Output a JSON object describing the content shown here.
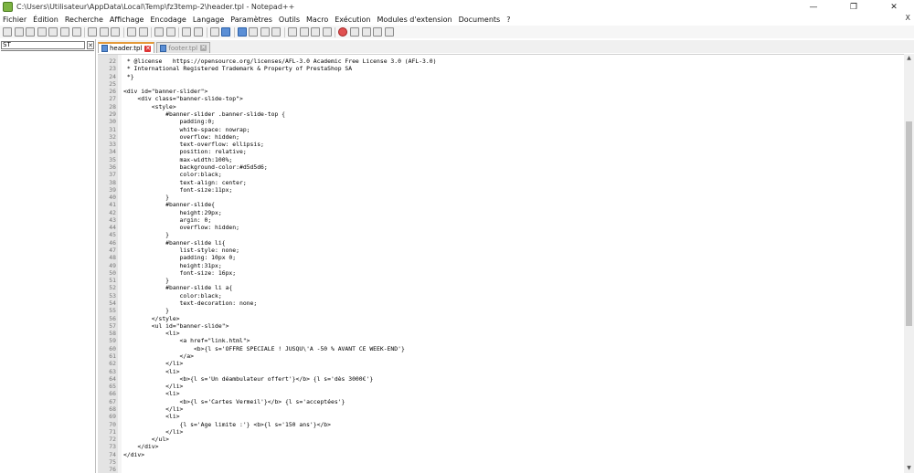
{
  "window": {
    "title": "C:\\Users\\Utilisateur\\AppData\\Local\\Temp\\fz3temp-2\\header.tpl - Notepad++",
    "minimize": "—",
    "maximize": "❐",
    "close": "✕"
  },
  "menu": {
    "items": [
      "Fichier",
      "Édition",
      "Recherche",
      "Affichage",
      "Encodage",
      "Langage",
      "Paramètres",
      "Outils",
      "Macro",
      "Exécution",
      "Modules d'extension",
      "Documents",
      "?"
    ],
    "close": "X"
  },
  "toolbar": {
    "buttons": [
      "new-file",
      "open-file",
      "save",
      "save-all",
      "close",
      "close-all",
      "print",
      "cut",
      "copy",
      "paste",
      "undo",
      "redo",
      "find",
      "replace",
      "zoom-in",
      "zoom-out",
      "sync-vertical",
      "sync-horizontal",
      "word-wrap",
      "show-all-chars",
      "indent-guide",
      "user-defined-language",
      "document-map",
      "function-list",
      "folder-as-workspace",
      "monitoring",
      "record-macro",
      "stop-recording",
      "play-macro",
      "run-macro-multiple",
      "save-macro"
    ]
  },
  "left_panel": {
    "search_value": "ST",
    "close": "✕"
  },
  "tabs": [
    {
      "label": "header.tpl",
      "active": true
    },
    {
      "label": "footer.tpl",
      "active": false
    }
  ],
  "editor": {
    "lines": [
      {
        "n": "22",
        "code": " * @license   https://opensource.org/licenses/AFL-3.0 Academic Free License 3.0 (AFL-3.0)"
      },
      {
        "n": "23",
        "code": " * International Registered Trademark & Property of PrestaShop SA"
      },
      {
        "n": "24",
        "code": " *}"
      },
      {
        "n": "25",
        "code": ""
      },
      {
        "n": "26",
        "code": "<div id=\"banner-slider\">"
      },
      {
        "n": "27",
        "code": "    <div class=\"banner-slide-top\">"
      },
      {
        "n": "28",
        "code": "        <style>"
      },
      {
        "n": "29",
        "code": "            #banner-slider .banner-slide-top {"
      },
      {
        "n": "30",
        "code": "                padding:0;"
      },
      {
        "n": "31",
        "code": "                white-space: nowrap;"
      },
      {
        "n": "32",
        "code": "                overflow: hidden;"
      },
      {
        "n": "33",
        "code": "                text-overflow: ellipsis;"
      },
      {
        "n": "34",
        "code": "                position: relative;"
      },
      {
        "n": "35",
        "code": "                max-width:100%;"
      },
      {
        "n": "36",
        "code": "                background-color:#d5d5d6;"
      },
      {
        "n": "37",
        "code": "                color:black;"
      },
      {
        "n": "38",
        "code": "                text-align: center;"
      },
      {
        "n": "39",
        "code": "                font-size:11px;"
      },
      {
        "n": "40",
        "code": "            }"
      },
      {
        "n": "41",
        "code": "            #banner-slide{"
      },
      {
        "n": "42",
        "code": "                height:29px;"
      },
      {
        "n": "43",
        "code": "                argin: 0;"
      },
      {
        "n": "44",
        "code": "                overflow: hidden;"
      },
      {
        "n": "45",
        "code": "            }"
      },
      {
        "n": "46",
        "code": "            #banner-slide li{"
      },
      {
        "n": "47",
        "code": "                list-style: none;"
      },
      {
        "n": "48",
        "code": "                padding: 10px 0;"
      },
      {
        "n": "49",
        "code": "                height:31px;"
      },
      {
        "n": "50",
        "code": "                font-size: 16px;"
      },
      {
        "n": "51",
        "code": "            }"
      },
      {
        "n": "52",
        "code": "            #banner-slide li a{"
      },
      {
        "n": "53",
        "code": "                color:black;"
      },
      {
        "n": "54",
        "code": "                text-decoration: none;"
      },
      {
        "n": "55",
        "code": "            }"
      },
      {
        "n": "56",
        "code": "        </style>"
      },
      {
        "n": "57",
        "code": "        <ul id=\"banner-slide\">"
      },
      {
        "n": "58",
        "code": "            <li>"
      },
      {
        "n": "59",
        "code": "                <a href=\"link.html\">"
      },
      {
        "n": "60",
        "code": "                    <b>{l s='OFFRE SPECIALE ! JUSQU\\'A -50 % AVANT CE WEEK-END'}"
      },
      {
        "n": "61",
        "code": "                </a>"
      },
      {
        "n": "62",
        "code": "            </li>"
      },
      {
        "n": "63",
        "code": "            <li>"
      },
      {
        "n": "64",
        "code": "                <b>{l s='Un déambulateur offert'}</b> {l s='dès 3000€'}"
      },
      {
        "n": "65",
        "code": "            </li>"
      },
      {
        "n": "66",
        "code": "            <li>"
      },
      {
        "n": "67",
        "code": "                <b>{l s='Cartes Vermeil'}</b> {l s='acceptées'}"
      },
      {
        "n": "68",
        "code": "            </li>"
      },
      {
        "n": "69",
        "code": "            <li>"
      },
      {
        "n": "70",
        "code": "                {l s='Age limite :'} <b>{l s='150 ans'}</b>"
      },
      {
        "n": "71",
        "code": "            </li>"
      },
      {
        "n": "72",
        "code": "        </ul>"
      },
      {
        "n": "73",
        "code": "    </div>"
      },
      {
        "n": "74",
        "code": "</div>"
      },
      {
        "n": "75",
        "code": ""
      },
      {
        "n": "76",
        "code": ""
      }
    ]
  },
  "scrollbar": {
    "up": "▲",
    "down": "▼"
  }
}
